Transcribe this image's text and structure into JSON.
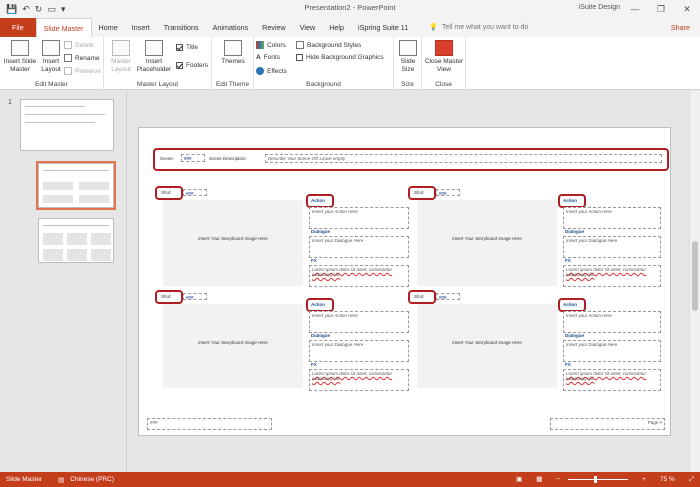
{
  "window": {
    "title": "Presentation2  -  PowerPoint",
    "user": "iSuite Design",
    "minimize": "—",
    "restore": "❐",
    "close": "✕"
  },
  "qat": {
    "save": "💾",
    "undo": "↶",
    "redo": "↻",
    "present": "▭",
    "more": "▾"
  },
  "tabs": [
    {
      "label": "File"
    },
    {
      "label": "Slide Master"
    },
    {
      "label": "Home"
    },
    {
      "label": "Insert"
    },
    {
      "label": "Transitions"
    },
    {
      "label": "Animations"
    },
    {
      "label": "Review"
    },
    {
      "label": "View"
    },
    {
      "label": "Help"
    },
    {
      "label": "iSpring Suite 11"
    }
  ],
  "tell_me": "Tell me what you want to do",
  "share": "Share",
  "ribbon": {
    "edit_master": {
      "label": "Edit Master",
      "insert_slide_master": "Insert Slide Master",
      "insert_layout": "Insert Layout",
      "delete": "Delete",
      "rename": "Rename",
      "preserve": "Preserve"
    },
    "master_layout": {
      "label": "Master Layout",
      "master_layout_btn": "Master Layout",
      "insert_placeholder": "Insert Placeholder",
      "title": "Title",
      "footers": "Footers"
    },
    "edit_theme": {
      "label": "Edit Theme",
      "themes": "Themes"
    },
    "background": {
      "label": "Background",
      "colors": "Colors",
      "fonts": "Fonts",
      "effects": "Effects",
      "background_styles": "Background Styles",
      "hide_background_graphics": "Hide Background Graphics"
    },
    "size": {
      "label": "Size",
      "slide_size": "Slide Size"
    },
    "close": {
      "label": "Close",
      "close_master_view": "Close Master View"
    }
  },
  "thumbs": {
    "number": "1"
  },
  "slide": {
    "scene_label": "Scene:",
    "scene_value": "###",
    "scene_desc_label": "Scene Description:",
    "scene_desc_placeholder": "Describe Your Scene OR Leave empty",
    "shot_label": "Shot:",
    "shot_value": "###",
    "action_label": "Action",
    "action_placeholder": "Insert your Action Here",
    "dialogue_label": "Dialogue",
    "dialogue_placeholder": "Insert your Dialogue Here",
    "fx_label": "FX",
    "fx_text": "Lorem ipsum dolor sit amet, consectetur adipiscing elit.",
    "image_text": "Insert Your Storyboard Image Here",
    "footer_left": "###",
    "footer_right": "Page #"
  },
  "status": {
    "view": "Slide Master",
    "language": "Chinese (PRC)",
    "zoom": "75 %"
  }
}
